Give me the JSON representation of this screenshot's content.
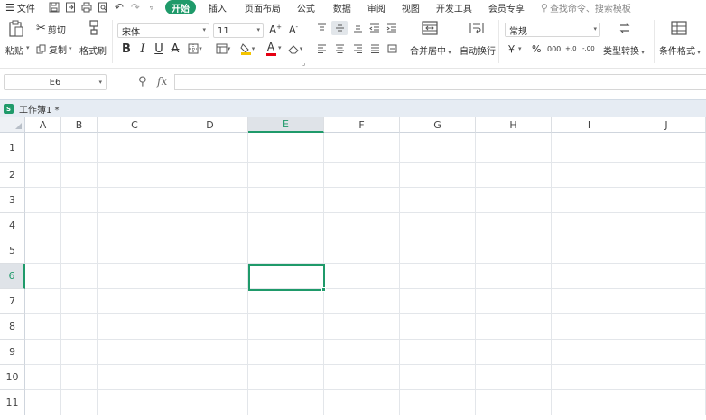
{
  "menu": {
    "file": "文件",
    "tabs": [
      "开始",
      "插入",
      "页面布局",
      "公式",
      "数据",
      "审阅",
      "视图",
      "开发工具",
      "会员专享"
    ],
    "active_tab": "开始",
    "search_placeholder": "查找命令、搜索模板",
    "quick_icons": [
      "save-icon",
      "export-icon",
      "print-icon",
      "print-preview-icon",
      "undo-icon",
      "redo-icon",
      "customize-dropdown-icon"
    ]
  },
  "ribbon": {
    "paste": "粘贴",
    "cut": "剪切",
    "copy": "复制",
    "format_painter": "格式刷",
    "font_name": "宋体",
    "font_size": "11",
    "merge_center": "合并居中",
    "wrap_text": "自动换行",
    "number_format": "常规",
    "type_convert": "类型转换",
    "conditional_format": "条件格式",
    "font_buttons": [
      "bold",
      "italic",
      "underline",
      "strikethrough",
      "borders",
      "cell-color",
      "fill-color",
      "font-color",
      "clear"
    ],
    "bold_label": "B",
    "italic_label": "I",
    "underline_label": "U",
    "strike_label": "A",
    "font_color_label": "A",
    "currency_symbol": "￥",
    "percent_symbol": "%",
    "thousands_symbol": "000",
    "inc_decimal_label": "+.0",
    "dec_decimal_label": "-.00",
    "accent_color": "#1f9a6a"
  },
  "formula_bar": {
    "name_box": "E6",
    "fx_label": "fx",
    "formula": ""
  },
  "workbook": {
    "name": "工作簿1 *",
    "icon_letter": "S"
  },
  "grid": {
    "columns": [
      "A",
      "B",
      "C",
      "D",
      "E",
      "F",
      "G",
      "H",
      "I",
      "J"
    ],
    "rows": [
      "1",
      "2",
      "3",
      "4",
      "5",
      "6",
      "7",
      "8",
      "9",
      "10",
      "11"
    ],
    "active_column": "E",
    "active_row": "6",
    "active_cell": "E6"
  }
}
